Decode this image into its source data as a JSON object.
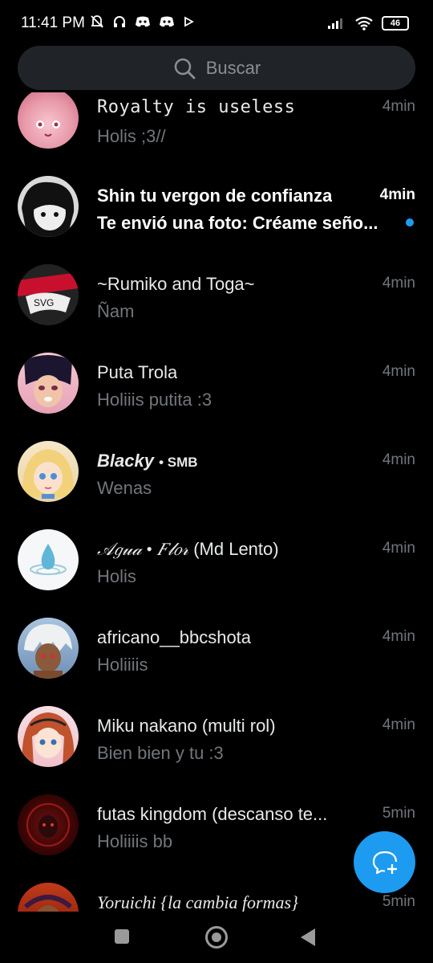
{
  "status_bar": {
    "time": "11:41 PM",
    "battery": "46",
    "icons": [
      "mute-icon",
      "headphones-icon",
      "discord-icon",
      "discord-icon",
      "play-icon",
      "signal-icon",
      "wifi-icon",
      "battery-icon"
    ]
  },
  "search": {
    "placeholder": "Buscar"
  },
  "conversations": [
    {
      "name": "Royalty is useless",
      "time": "4min",
      "message": "Holis ;3//",
      "unread": false
    },
    {
      "name": "Shin tu vergon de confianza",
      "time": "4min",
      "message": "Te envió una foto: Créame seño...",
      "unread": true
    },
    {
      "name": "~Rumiko and Toga~",
      "time": "4min",
      "message": "Ñam",
      "unread": false
    },
    {
      "name": "Puta Trola",
      "time": "4min",
      "message": "Holiiis putita :3",
      "unread": false
    },
    {
      "name": "Blacky",
      "tag": "• SMB",
      "time": "4min",
      "message": "Wenas",
      "unread": false
    },
    {
      "name_part1": "𝒜𝑔𝓊𝒶 • 𝐹𝓁𝑜𝓇",
      "name_part2": "(Md Lento)",
      "time": "4min",
      "message": "Holis",
      "unread": false
    },
    {
      "name": "africano__bbcshota",
      "time": "4min",
      "message": "Holiiiis",
      "unread": false
    },
    {
      "name": "Miku nakano (multi rol)",
      "time": "4min",
      "message": "Bien bien y tu :3",
      "unread": false
    },
    {
      "name": "futas kingdom (descanso te...",
      "time": "5min",
      "message": "Holiiiis bb",
      "unread": false
    },
    {
      "name": "Yoruichi {la cambia formas}",
      "time": "5min",
      "message": "",
      "unread": false
    }
  ],
  "colors": {
    "accent": "#1d9bf0",
    "background": "#000000",
    "secondary_text": "#71767b"
  }
}
